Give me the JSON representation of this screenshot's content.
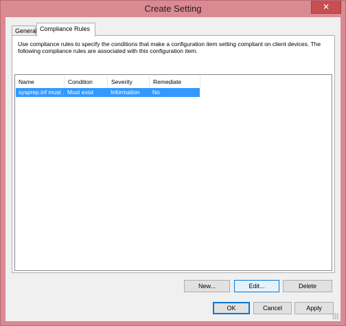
{
  "window": {
    "title": "Create Setting",
    "close_glyph": "✕",
    "title_bar_color": "#d98a93",
    "close_button_color": "#c74f4f"
  },
  "tabs": [
    {
      "label": "General",
      "active": false
    },
    {
      "label": "Compliance Rules",
      "active": true
    }
  ],
  "compliance": {
    "description": "Use compliance rules to specify the conditions that make a configuration item setting compliant on client devices. The following compliance rules are associated with this configuration item.",
    "columns": [
      "Name",
      "Condition",
      "Severity",
      "Remediate"
    ],
    "rows": [
      {
        "name": "sysprep.inf must ...",
        "condition": "Must exist",
        "severity": "Information",
        "remediate": "No",
        "selected": true
      }
    ],
    "selection_color": "#3399ff"
  },
  "buttons": {
    "new": "New...",
    "edit": "Edit...",
    "delete": "Delete",
    "ok": "OK",
    "cancel": "Cancel",
    "apply": "Apply"
  }
}
